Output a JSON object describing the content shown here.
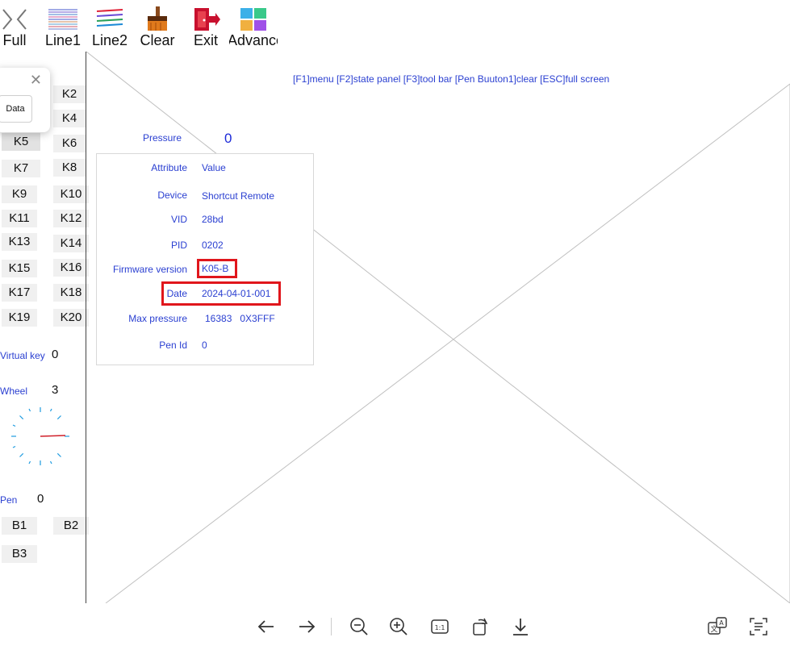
{
  "toolbar": {
    "buttons": [
      {
        "label": "Full",
        "icon": "fullscreen-chevrons-icon"
      },
      {
        "label": "Line1",
        "icon": "line1-icon"
      },
      {
        "label": "Line2",
        "icon": "line2-icon"
      },
      {
        "label": "Clear",
        "icon": "broom-icon"
      },
      {
        "label": "Exit",
        "icon": "exit-door-icon"
      },
      {
        "label": "Advance",
        "icon": "advance-tiles-icon"
      }
    ]
  },
  "left_panel": {
    "keys": [
      "K2",
      "K4",
      "K5",
      "K6",
      "K7",
      "K8",
      "K9",
      "K10",
      "K11",
      "K12",
      "K13",
      "K14",
      "K15",
      "K16",
      "K17",
      "K18",
      "K19",
      "K20"
    ],
    "virtual_key": {
      "label": "Virtual key",
      "value": "0"
    },
    "wheel": {
      "label": "Wheel",
      "value": "3"
    },
    "pen": {
      "label": "Pen",
      "value": "0"
    },
    "pen_buttons": [
      "B1",
      "B2",
      "B3"
    ]
  },
  "popup": {
    "button_label": "Data"
  },
  "canvas": {
    "help_text": "[F1]menu [F2]state panel [F3]tool bar [Pen Buuton1]clear [ESC]full screen",
    "pressure": {
      "label": "Pressure",
      "value": "0"
    },
    "info": {
      "header": {
        "label": "Attribute",
        "value": "Value"
      },
      "device": {
        "label": "Device",
        "value": "Shortcut Remote"
      },
      "vid": {
        "label": "VID",
        "value": "28bd"
      },
      "pid": {
        "label": "PID",
        "value": "0202"
      },
      "firmware": {
        "label": "Firmware version",
        "value": "K05-B"
      },
      "date": {
        "label": "Date",
        "value": "2024-04-01-001"
      },
      "max_pressure": {
        "label": "Max pressure",
        "value": "16383   0X3FFF"
      },
      "pen_id": {
        "label": "Pen Id",
        "value": "0"
      }
    }
  },
  "viewer_bar": {
    "icons": [
      "arrow-left-icon",
      "arrow-right-icon",
      "zoom-out-icon",
      "zoom-in-icon",
      "actual-size-icon",
      "rotate-icon",
      "download-icon",
      "translate-icon",
      "text-extract-icon"
    ]
  },
  "colors": {
    "label_blue": "#2a3fd1",
    "highlight_red": "#e0161c"
  }
}
